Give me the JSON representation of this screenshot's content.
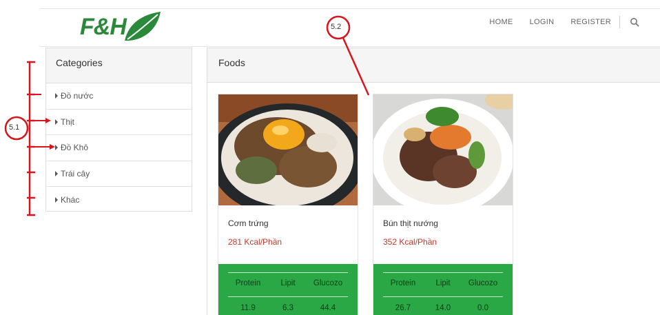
{
  "brand": {
    "logo_text": "F&H",
    "primary_color": "#2a8a3a",
    "accent_green": "#2aa845",
    "kcal_color": "#c0392b"
  },
  "nav": {
    "items": [
      "HOME",
      "LOGIN",
      "REGISTER"
    ],
    "search_icon": "search-icon"
  },
  "sidebar": {
    "title": "Categories",
    "items": [
      "Đồ nước",
      "Thịt",
      "Đồ Khô",
      "Trái cây",
      "Khác"
    ]
  },
  "foods": {
    "title": "Foods",
    "columns": [
      "Protein",
      "Lipit",
      "Glucozo"
    ],
    "cards": [
      {
        "name": "Cơm trứng",
        "kcal": "281 Kcal/Phần",
        "protein": "11.9",
        "lipit": "6.3",
        "glucozo": "44.4"
      },
      {
        "name": "Bún thịt nướng",
        "kcal": "352 Kcal/Phần",
        "protein": "26.7",
        "lipit": "14.0",
        "glucozo": "0.0"
      }
    ]
  },
  "annotations": {
    "left_label": "5.1",
    "top_label": "5.2"
  }
}
